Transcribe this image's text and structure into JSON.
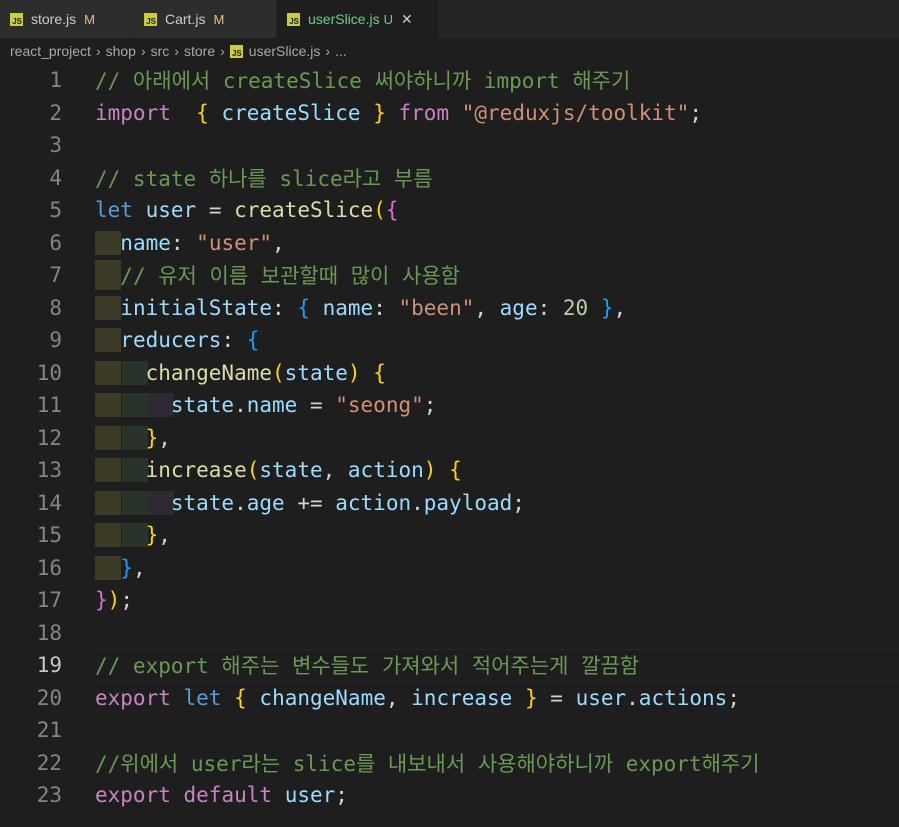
{
  "tabs": [
    {
      "label": "store.js",
      "status": "M",
      "active": false
    },
    {
      "label": "Cart.js",
      "status": "M",
      "active": false
    },
    {
      "label": "userSlice.js",
      "status": "U",
      "active": true
    }
  ],
  "breadcrumb": [
    "react_project",
    "shop",
    "src",
    "store",
    "userSlice.js",
    "..."
  ],
  "icons": {
    "js_file": "JS",
    "close": "✕"
  },
  "editor": {
    "current_line": 19,
    "line_numbers": [
      "1",
      "2",
      "3",
      "4",
      "5",
      "6",
      "7",
      "8",
      "9",
      "10",
      "11",
      "12",
      "13",
      "14",
      "15",
      "16",
      "17",
      "18",
      "19",
      "20",
      "21",
      "22",
      "23"
    ],
    "lines": [
      [
        [
          "cm",
          "// 아래에서 createSlice 써야하니까 import 해주기"
        ]
      ],
      [
        [
          "kw",
          "import"
        ],
        [
          "",
          "  "
        ],
        [
          "br1",
          "{"
        ],
        [
          "",
          " "
        ],
        [
          "vr",
          "createSlice"
        ],
        [
          "",
          " "
        ],
        [
          "br1",
          "}"
        ],
        [
          "",
          " "
        ],
        [
          "kw",
          "from"
        ],
        [
          "",
          " "
        ],
        [
          "s",
          "\"@reduxjs/toolkit\""
        ],
        [
          "",
          ";"
        ]
      ],
      [],
      [
        [
          "cm",
          "// state 하나를 slice라고 부름"
        ]
      ],
      [
        [
          "st",
          "let"
        ],
        [
          "",
          " "
        ],
        [
          "vr",
          "user"
        ],
        [
          "",
          " = "
        ],
        [
          "fn",
          "createSlice"
        ],
        [
          "br1",
          "("
        ],
        [
          "br2",
          "{"
        ]
      ],
      [
        [
          "",
          "  "
        ],
        [
          "vr",
          "name"
        ],
        [
          "",
          ": "
        ],
        [
          "s",
          "\"user\""
        ],
        [
          "",
          ","
        ]
      ],
      [
        [
          "",
          "  "
        ],
        [
          "cm",
          "// 유저 이름 보관할때 많이 사용함"
        ]
      ],
      [
        [
          "",
          "  "
        ],
        [
          "vr",
          "initialState"
        ],
        [
          "",
          ": "
        ],
        [
          "br3",
          "{"
        ],
        [
          "",
          " "
        ],
        [
          "vr",
          "name"
        ],
        [
          "",
          ": "
        ],
        [
          "s",
          "\"been\""
        ],
        [
          "",
          ", "
        ],
        [
          "vr",
          "age"
        ],
        [
          "",
          ": "
        ],
        [
          "nm",
          "20"
        ],
        [
          "",
          " "
        ],
        [
          "br3",
          "}"
        ],
        [
          "",
          ","
        ]
      ],
      [
        [
          "",
          "  "
        ],
        [
          "vr",
          "reducers"
        ],
        [
          "",
          ": "
        ],
        [
          "br3",
          "{"
        ]
      ],
      [
        [
          "",
          "    "
        ],
        [
          "fn",
          "changeName"
        ],
        [
          "br1",
          "("
        ],
        [
          "vr",
          "state"
        ],
        [
          "br1",
          ")"
        ],
        [
          "",
          " "
        ],
        [
          "br1",
          "{"
        ]
      ],
      [
        [
          "",
          "      "
        ],
        [
          "vr",
          "state"
        ],
        [
          "",
          "."
        ],
        [
          "vr",
          "name"
        ],
        [
          "",
          " = "
        ],
        [
          "s",
          "\"seong\""
        ],
        [
          "",
          ";"
        ]
      ],
      [
        [
          "",
          "    "
        ],
        [
          "br1",
          "}"
        ],
        [
          "",
          ","
        ]
      ],
      [
        [
          "",
          "    "
        ],
        [
          "fn",
          "increase"
        ],
        [
          "br1",
          "("
        ],
        [
          "vr",
          "state"
        ],
        [
          "",
          ", "
        ],
        [
          "vr",
          "action"
        ],
        [
          "br1",
          ")"
        ],
        [
          "",
          " "
        ],
        [
          "br1",
          "{"
        ]
      ],
      [
        [
          "",
          "      "
        ],
        [
          "vr",
          "state"
        ],
        [
          "",
          "."
        ],
        [
          "vr",
          "age"
        ],
        [
          "",
          " += "
        ],
        [
          "vr",
          "action"
        ],
        [
          "",
          "."
        ],
        [
          "vr",
          "payload"
        ],
        [
          "",
          ";"
        ]
      ],
      [
        [
          "",
          "    "
        ],
        [
          "br1",
          "}"
        ],
        [
          "",
          ","
        ]
      ],
      [
        [
          "",
          "  "
        ],
        [
          "br3",
          "}"
        ],
        [
          "",
          ","
        ]
      ],
      [
        [
          "br2",
          "}"
        ],
        [
          "br1",
          ")"
        ],
        [
          "",
          ";"
        ]
      ],
      [],
      [
        [
          "cm",
          "// export 해주는 변수들도 가져와서 적어주는게 깔끔함"
        ]
      ],
      [
        [
          "kw",
          "export"
        ],
        [
          "",
          " "
        ],
        [
          "st",
          "let"
        ],
        [
          "",
          " "
        ],
        [
          "br1",
          "{"
        ],
        [
          "",
          " "
        ],
        [
          "vr",
          "changeName"
        ],
        [
          "",
          ", "
        ],
        [
          "vr",
          "increase"
        ],
        [
          "",
          " "
        ],
        [
          "br1",
          "}"
        ],
        [
          "",
          " = "
        ],
        [
          "vr",
          "user"
        ],
        [
          "",
          "."
        ],
        [
          "vr",
          "actions"
        ],
        [
          "",
          ";"
        ]
      ],
      [],
      [
        [
          "cm",
          "//위에서 user라는 slice를 내보내서 사용해야하니까 export해주기"
        ]
      ],
      [
        [
          "kw",
          "export"
        ],
        [
          "",
          " "
        ],
        [
          "kw",
          "default"
        ],
        [
          "",
          " "
        ],
        [
          "vr",
          "user"
        ],
        [
          "",
          ";"
        ]
      ]
    ]
  },
  "colors": {
    "background": "#1e1e1e",
    "comment": "#6a9955",
    "keyword": "#c586c0",
    "storage": "#569cd6",
    "variable": "#9cdcfe",
    "function": "#dcdcaa",
    "string": "#ce9178",
    "number": "#b5cea8",
    "modified": "#e2c08d",
    "untracked": "#73c991"
  }
}
